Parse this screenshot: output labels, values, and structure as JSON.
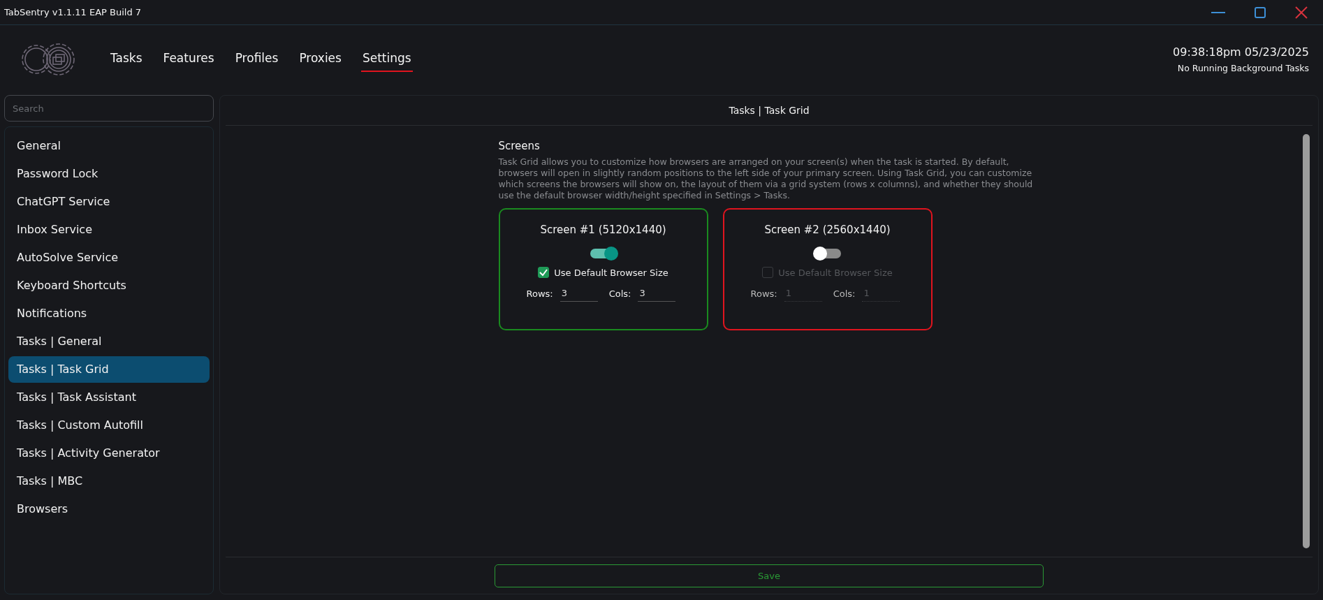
{
  "window": {
    "title": "TabSentry v1.1.11 EAP Build 7"
  },
  "nav": [
    {
      "label": "Tasks",
      "selected": false
    },
    {
      "label": "Features",
      "selected": false
    },
    {
      "label": "Profiles",
      "selected": false
    },
    {
      "label": "Proxies",
      "selected": false
    },
    {
      "label": "Settings",
      "selected": true
    }
  ],
  "clock": "09:38:18pm 05/23/2025",
  "background_status": "No Running Background Tasks",
  "sidebar": {
    "search": {
      "placeholder": "Search"
    },
    "items": [
      {
        "label": "General",
        "selected": false
      },
      {
        "label": "Password Lock",
        "selected": false
      },
      {
        "label": "ChatGPT Service",
        "selected": false
      },
      {
        "label": "Inbox Service",
        "selected": false
      },
      {
        "label": "AutoSolve Service",
        "selected": false
      },
      {
        "label": "Keyboard Shortcuts",
        "selected": false
      },
      {
        "label": "Notifications",
        "selected": false
      },
      {
        "label": "Tasks | General",
        "selected": false
      },
      {
        "label": "Tasks | Task Grid",
        "selected": true
      },
      {
        "label": "Tasks | Task Assistant",
        "selected": false
      },
      {
        "label": "Tasks | Custom Autofill",
        "selected": false
      },
      {
        "label": "Tasks | Activity Generator",
        "selected": false
      },
      {
        "label": "Tasks | MBC",
        "selected": false
      },
      {
        "label": "Browsers",
        "selected": false
      }
    ]
  },
  "panel": {
    "title": "Tasks | Task Grid",
    "section_title": "Screens",
    "description": "Task Grid allows you to customize how browsers are arranged on your screen(s) when the task is started. By default, browsers will open in slightly random positions to the left side of your primary screen. Using Task Grid, you can customize which screens the browsers will show on, the layout of them via a grid system (rows x columns), and whether they should use the default browser width/height specified in Settings > Tasks.",
    "screens": [
      {
        "title": "Screen #1 (5120x1440)",
        "on": true,
        "default_size_label": "Use Default Browser Size",
        "default_size_checked": true,
        "rows_label": "Rows:",
        "rows": "3",
        "cols_label": "Cols:",
        "cols": "3"
      },
      {
        "title": "Screen #2 (2560x1440)",
        "on": false,
        "default_size_label": "Use Default Browser Size",
        "default_size_checked": false,
        "rows_label": "Rows:",
        "rows": "1",
        "cols_label": "Cols:",
        "cols": "1"
      }
    ],
    "save_button": "Save"
  }
}
